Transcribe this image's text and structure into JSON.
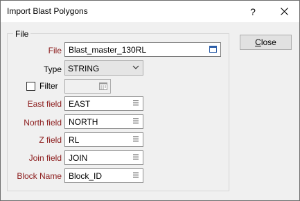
{
  "window": {
    "title": "Import Blast Polygons",
    "help_glyph": "?",
    "close_glyph": "✕"
  },
  "group": {
    "legend": "File"
  },
  "file": {
    "label": "File",
    "value": "Blast_master_130RL",
    "icon": "file-browse-icon"
  },
  "type": {
    "label": "Type",
    "value": "STRING",
    "icon": "chevron-down-icon"
  },
  "filter": {
    "label": "Filter",
    "checked": false,
    "value": "",
    "icon": "filter-browse-icon"
  },
  "fields": [
    {
      "label": "East field",
      "value": "EAST"
    },
    {
      "label": "North field",
      "value": "NORTH"
    },
    {
      "label": "Z field",
      "value": "RL"
    },
    {
      "label": "Join field",
      "value": "JOIN"
    },
    {
      "label": "Block Name",
      "value": "Block_ID"
    }
  ],
  "buttons": {
    "close_prefix": "",
    "close_mnemonic": "C",
    "close_rest": "lose"
  },
  "colors": {
    "required_label": "#8b1a1a",
    "window_bg": "#f0f0f0"
  }
}
